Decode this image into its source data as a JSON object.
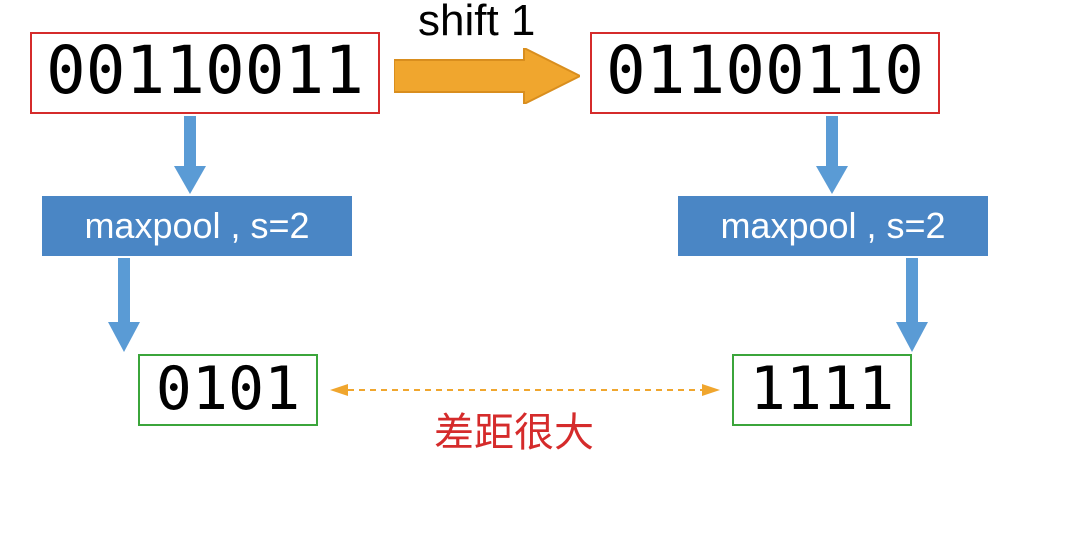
{
  "input_left": "00110011",
  "input_right": "01100110",
  "shift_label": "shift 1",
  "op_label": "maxpool , s=2",
  "output_left": "0101",
  "output_right": "1111",
  "difference_label": "差距很大",
  "colors": {
    "input_border": "#d52b2b",
    "output_border": "#3ba53b",
    "op_bg": "#4a86c5",
    "blue_arrow": "#5a9bd5",
    "orange_arrow": "#f0a62e",
    "dashed_arrow": "#f0a62e",
    "diff_text": "#d52b2b"
  }
}
